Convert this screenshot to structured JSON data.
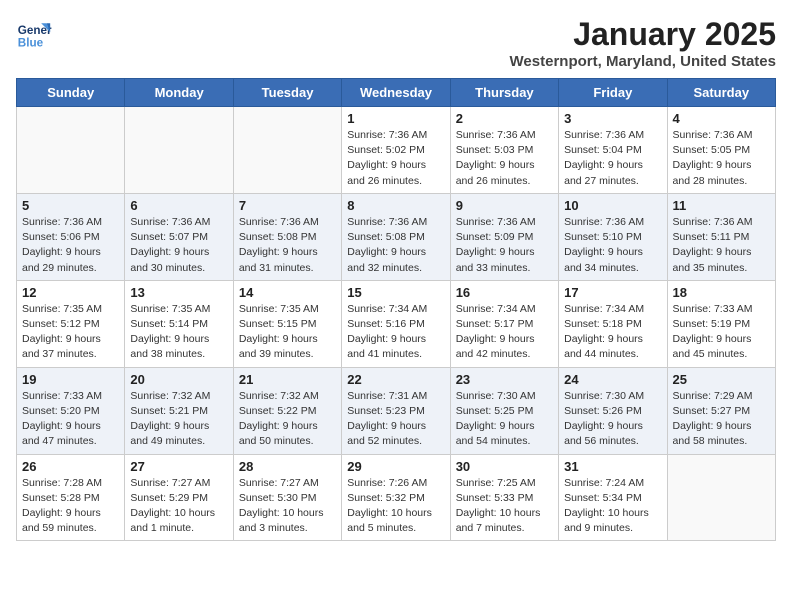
{
  "header": {
    "logo_line1": "General",
    "logo_line2": "Blue",
    "month_year": "January 2025",
    "location": "Westernport, Maryland, United States"
  },
  "weekdays": [
    "Sunday",
    "Monday",
    "Tuesday",
    "Wednesday",
    "Thursday",
    "Friday",
    "Saturday"
  ],
  "weeks": [
    [
      {
        "day": "",
        "info": ""
      },
      {
        "day": "",
        "info": ""
      },
      {
        "day": "",
        "info": ""
      },
      {
        "day": "1",
        "info": "Sunrise: 7:36 AM\nSunset: 5:02 PM\nDaylight: 9 hours and 26 minutes."
      },
      {
        "day": "2",
        "info": "Sunrise: 7:36 AM\nSunset: 5:03 PM\nDaylight: 9 hours and 26 minutes."
      },
      {
        "day": "3",
        "info": "Sunrise: 7:36 AM\nSunset: 5:04 PM\nDaylight: 9 hours and 27 minutes."
      },
      {
        "day": "4",
        "info": "Sunrise: 7:36 AM\nSunset: 5:05 PM\nDaylight: 9 hours and 28 minutes."
      }
    ],
    [
      {
        "day": "5",
        "info": "Sunrise: 7:36 AM\nSunset: 5:06 PM\nDaylight: 9 hours and 29 minutes."
      },
      {
        "day": "6",
        "info": "Sunrise: 7:36 AM\nSunset: 5:07 PM\nDaylight: 9 hours and 30 minutes."
      },
      {
        "day": "7",
        "info": "Sunrise: 7:36 AM\nSunset: 5:08 PM\nDaylight: 9 hours and 31 minutes."
      },
      {
        "day": "8",
        "info": "Sunrise: 7:36 AM\nSunset: 5:08 PM\nDaylight: 9 hours and 32 minutes."
      },
      {
        "day": "9",
        "info": "Sunrise: 7:36 AM\nSunset: 5:09 PM\nDaylight: 9 hours and 33 minutes."
      },
      {
        "day": "10",
        "info": "Sunrise: 7:36 AM\nSunset: 5:10 PM\nDaylight: 9 hours and 34 minutes."
      },
      {
        "day": "11",
        "info": "Sunrise: 7:36 AM\nSunset: 5:11 PM\nDaylight: 9 hours and 35 minutes."
      }
    ],
    [
      {
        "day": "12",
        "info": "Sunrise: 7:35 AM\nSunset: 5:12 PM\nDaylight: 9 hours and 37 minutes."
      },
      {
        "day": "13",
        "info": "Sunrise: 7:35 AM\nSunset: 5:14 PM\nDaylight: 9 hours and 38 minutes."
      },
      {
        "day": "14",
        "info": "Sunrise: 7:35 AM\nSunset: 5:15 PM\nDaylight: 9 hours and 39 minutes."
      },
      {
        "day": "15",
        "info": "Sunrise: 7:34 AM\nSunset: 5:16 PM\nDaylight: 9 hours and 41 minutes."
      },
      {
        "day": "16",
        "info": "Sunrise: 7:34 AM\nSunset: 5:17 PM\nDaylight: 9 hours and 42 minutes."
      },
      {
        "day": "17",
        "info": "Sunrise: 7:34 AM\nSunset: 5:18 PM\nDaylight: 9 hours and 44 minutes."
      },
      {
        "day": "18",
        "info": "Sunrise: 7:33 AM\nSunset: 5:19 PM\nDaylight: 9 hours and 45 minutes."
      }
    ],
    [
      {
        "day": "19",
        "info": "Sunrise: 7:33 AM\nSunset: 5:20 PM\nDaylight: 9 hours and 47 minutes."
      },
      {
        "day": "20",
        "info": "Sunrise: 7:32 AM\nSunset: 5:21 PM\nDaylight: 9 hours and 49 minutes."
      },
      {
        "day": "21",
        "info": "Sunrise: 7:32 AM\nSunset: 5:22 PM\nDaylight: 9 hours and 50 minutes."
      },
      {
        "day": "22",
        "info": "Sunrise: 7:31 AM\nSunset: 5:23 PM\nDaylight: 9 hours and 52 minutes."
      },
      {
        "day": "23",
        "info": "Sunrise: 7:30 AM\nSunset: 5:25 PM\nDaylight: 9 hours and 54 minutes."
      },
      {
        "day": "24",
        "info": "Sunrise: 7:30 AM\nSunset: 5:26 PM\nDaylight: 9 hours and 56 minutes."
      },
      {
        "day": "25",
        "info": "Sunrise: 7:29 AM\nSunset: 5:27 PM\nDaylight: 9 hours and 58 minutes."
      }
    ],
    [
      {
        "day": "26",
        "info": "Sunrise: 7:28 AM\nSunset: 5:28 PM\nDaylight: 9 hours and 59 minutes."
      },
      {
        "day": "27",
        "info": "Sunrise: 7:27 AM\nSunset: 5:29 PM\nDaylight: 10 hours and 1 minute."
      },
      {
        "day": "28",
        "info": "Sunrise: 7:27 AM\nSunset: 5:30 PM\nDaylight: 10 hours and 3 minutes."
      },
      {
        "day": "29",
        "info": "Sunrise: 7:26 AM\nSunset: 5:32 PM\nDaylight: 10 hours and 5 minutes."
      },
      {
        "day": "30",
        "info": "Sunrise: 7:25 AM\nSunset: 5:33 PM\nDaylight: 10 hours and 7 minutes."
      },
      {
        "day": "31",
        "info": "Sunrise: 7:24 AM\nSunset: 5:34 PM\nDaylight: 10 hours and 9 minutes."
      },
      {
        "day": "",
        "info": ""
      }
    ]
  ]
}
